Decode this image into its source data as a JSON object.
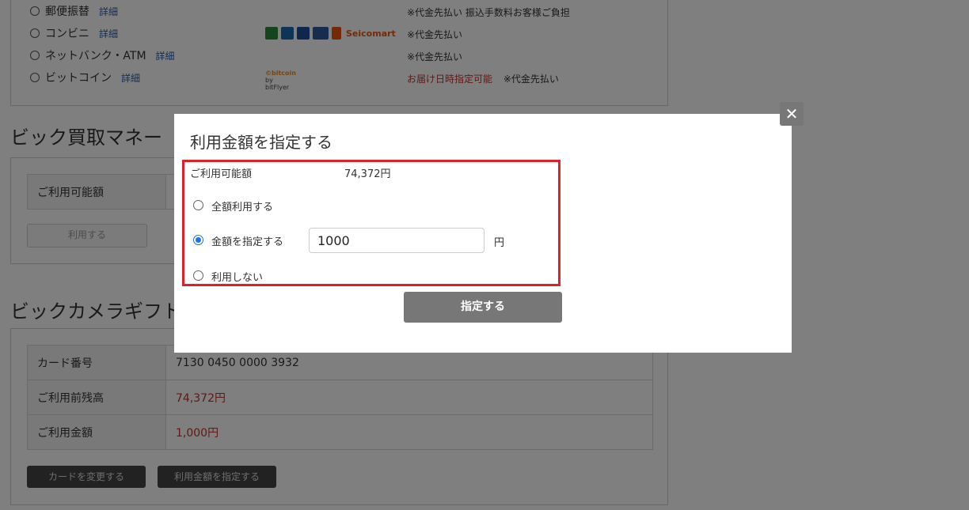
{
  "payment": {
    "detail_label": "詳細",
    "options": [
      {
        "label": "郵便振替",
        "note": "※代金先払い 振込手数料お客様ご負担"
      },
      {
        "label": "コンビニ",
        "note": "※代金先払い"
      },
      {
        "label": "ネットバンク・ATM",
        "note": "※代金先払い"
      },
      {
        "label": "ビットコイン",
        "note_red": "お届け日時指定可能",
        "note": "※代金先払い"
      }
    ],
    "seicomart_text": "Seicomart",
    "bitcoin_text": "©bitcoin",
    "bitcoin_sub": "by bitFlyer"
  },
  "kaitori": {
    "title": "ビック買取マネー",
    "available_label": "ご利用可能額",
    "use_button": "利用する"
  },
  "gift": {
    "title": "ビックカメラギフト",
    "rows": [
      {
        "label": "カード番号",
        "value": "7130 0450 0000 3932"
      },
      {
        "label": "ご利用前残高",
        "value": "74,372円"
      },
      {
        "label": "ご利用金額",
        "value": "1,000円"
      }
    ],
    "change_card_button": "カードを変更する",
    "specify_amount_button": "利用金額を指定する"
  },
  "modal": {
    "title": "利用金額を指定する",
    "available_label": "ご利用可能額",
    "available_value": "74,372円",
    "option_full": "全額利用する",
    "option_specify": "金額を指定する",
    "option_none": "利用しない",
    "amount_value": "1000",
    "currency_unit": "円",
    "submit_label": "指定する",
    "close_symbol": "✕"
  },
  "colors": {
    "highlight_border": "#e0202a",
    "price_red": "#c03030",
    "radio_selected": "#1a73e8"
  }
}
